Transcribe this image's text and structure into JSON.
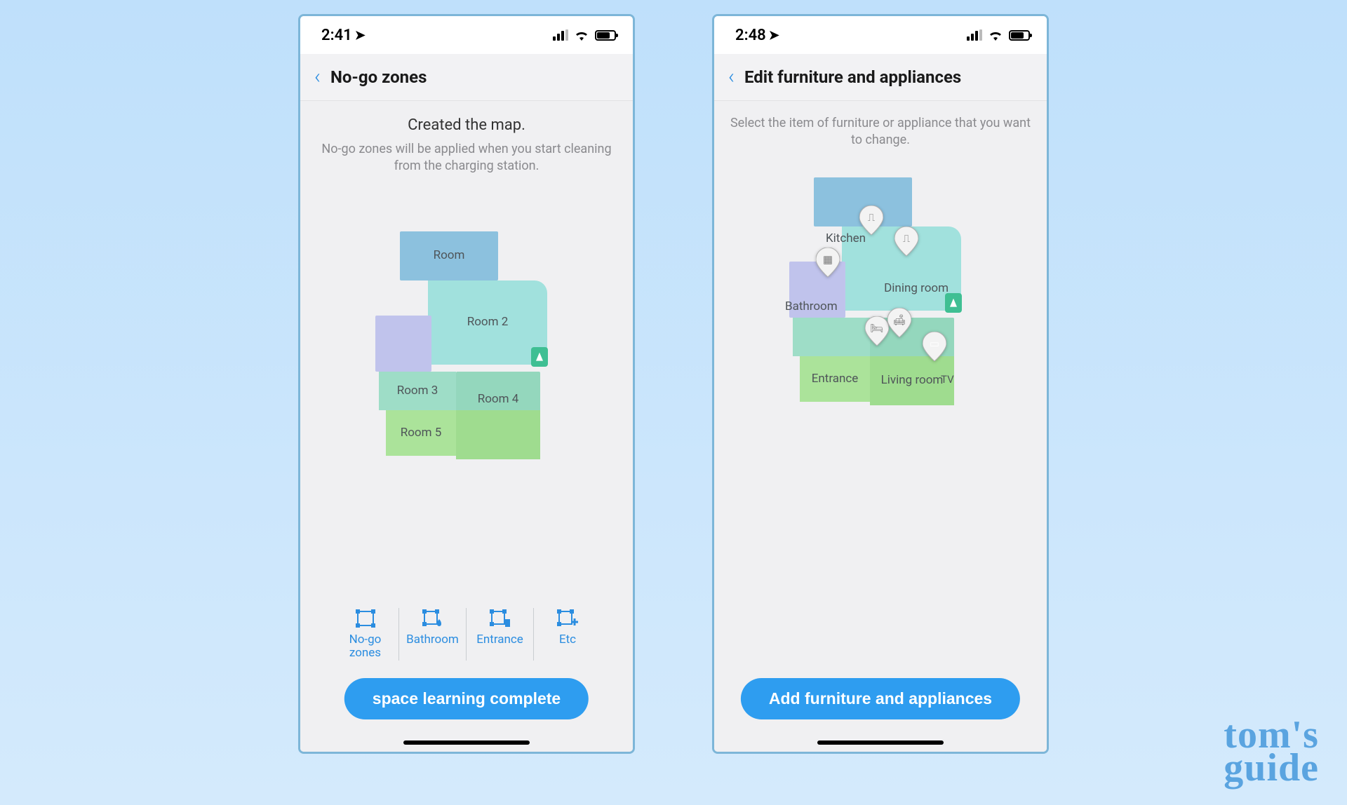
{
  "watermark": {
    "line1": "tom's",
    "line2": "guide"
  },
  "phone1": {
    "status": {
      "time": "2:41"
    },
    "header": {
      "title": "No-go zones"
    },
    "headline": "Created the map.",
    "subtext": "No-go zones will be applied when you start cleaning from the charging station.",
    "rooms": {
      "top": "Room",
      "dining": "Room 2",
      "bath": "",
      "r3": "Room 3",
      "r4": "Room 4",
      "r5": "Room 5",
      "live": ""
    },
    "tools": [
      {
        "label": "No-go zones"
      },
      {
        "label": "Bathroom"
      },
      {
        "label": "Entrance"
      },
      {
        "label": "Etc"
      }
    ],
    "primary": "space learning complete"
  },
  "phone2": {
    "status": {
      "time": "2:48"
    },
    "header": {
      "title": "Edit furniture and appliances"
    },
    "subtext": "Select the item of furniture or appliance that you want to change.",
    "rooms": {
      "top": "",
      "kitchen": "Kitchen",
      "dining": "Dining room",
      "bath": "Bathroom",
      "entrance": "Entrance",
      "live": "Living room",
      "tv": "TV"
    },
    "primary": "Add furniture and appliances"
  }
}
